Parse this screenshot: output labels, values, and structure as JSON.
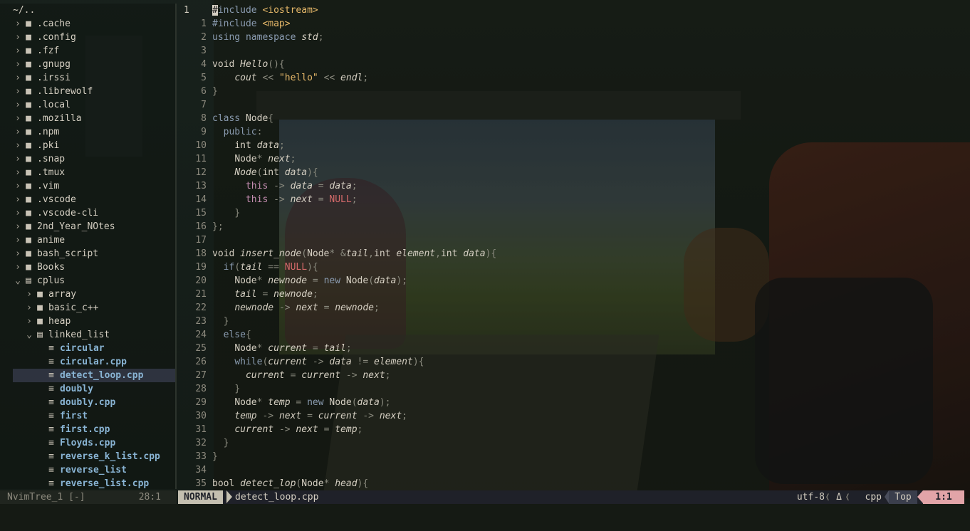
{
  "tree": {
    "root": "~/..",
    "items": [
      {
        "label": ".cache",
        "type": "folder",
        "depth": 0,
        "open": false
      },
      {
        "label": ".config",
        "type": "folder",
        "depth": 0,
        "open": false
      },
      {
        "label": ".fzf",
        "type": "folder",
        "depth": 0,
        "open": false
      },
      {
        "label": ".gnupg",
        "type": "folder",
        "depth": 0,
        "open": false
      },
      {
        "label": ".irssi",
        "type": "folder",
        "depth": 0,
        "open": false
      },
      {
        "label": ".librewolf",
        "type": "folder",
        "depth": 0,
        "open": false
      },
      {
        "label": ".local",
        "type": "folder",
        "depth": 0,
        "open": false
      },
      {
        "label": ".mozilla",
        "type": "folder",
        "depth": 0,
        "open": false
      },
      {
        "label": ".npm",
        "type": "folder",
        "depth": 0,
        "open": false
      },
      {
        "label": ".pki",
        "type": "folder",
        "depth": 0,
        "open": false
      },
      {
        "label": ".snap",
        "type": "folder",
        "depth": 0,
        "open": false
      },
      {
        "label": ".tmux",
        "type": "folder",
        "depth": 0,
        "open": false
      },
      {
        "label": ".vim",
        "type": "folder",
        "depth": 0,
        "open": false
      },
      {
        "label": ".vscode",
        "type": "folder",
        "depth": 0,
        "open": false
      },
      {
        "label": ".vscode-cli",
        "type": "folder",
        "depth": 0,
        "open": false
      },
      {
        "label": "2nd_Year_NOtes",
        "type": "folder",
        "depth": 0,
        "open": false
      },
      {
        "label": "anime",
        "type": "folder",
        "depth": 0,
        "open": false
      },
      {
        "label": "bash_script",
        "type": "folder",
        "depth": 0,
        "open": false
      },
      {
        "label": "Books",
        "type": "folder",
        "depth": 0,
        "open": false
      },
      {
        "label": "cplus",
        "type": "folder",
        "depth": 0,
        "open": true
      },
      {
        "label": "array",
        "type": "folder",
        "depth": 1,
        "open": false
      },
      {
        "label": "basic_c++",
        "type": "folder",
        "depth": 1,
        "open": false
      },
      {
        "label": "heap",
        "type": "folder",
        "depth": 1,
        "open": false
      },
      {
        "label": "linked_list",
        "type": "folder",
        "depth": 1,
        "open": true
      },
      {
        "label": "circular",
        "type": "file",
        "depth": 2
      },
      {
        "label": "circular.cpp",
        "type": "file",
        "depth": 2
      },
      {
        "label": "detect_loop.cpp",
        "type": "file",
        "depth": 2,
        "selected": true
      },
      {
        "label": "doubly",
        "type": "file",
        "depth": 2
      },
      {
        "label": "doubly.cpp",
        "type": "file",
        "depth": 2
      },
      {
        "label": "first",
        "type": "file",
        "depth": 2
      },
      {
        "label": "first.cpp",
        "type": "file",
        "depth": 2
      },
      {
        "label": "Floyds.cpp",
        "type": "file",
        "depth": 2
      },
      {
        "label": "reverse_k_list.cpp",
        "type": "file",
        "depth": 2
      },
      {
        "label": "reverse_list",
        "type": "file",
        "depth": 2
      },
      {
        "label": "reverse_list.cpp",
        "type": "file",
        "depth": 2
      }
    ]
  },
  "editor": {
    "lines": [
      {
        "n": "1",
        "cur": true,
        "html": "<span class=\"cursor\">#</span><span class=\"inc\">include</span> <span class=\"ang\">&lt;iostream&gt;</span>"
      },
      {
        "n": "1",
        "html": "<span class=\"inc\">#include</span> <span class=\"ang\">&lt;map&gt;</span>"
      },
      {
        "n": "2",
        "html": "<span class=\"k\">using namespace</span> <span class=\"v\">std</span><span class=\"p\">;</span>"
      },
      {
        "n": "3",
        "html": ""
      },
      {
        "n": "4",
        "html": "<span class=\"t\">void</span> <span class=\"fn\">Hello</span><span class=\"p\">(){</span>"
      },
      {
        "n": "5",
        "html": "    <span class=\"v\">cout</span> <span class=\"p\">&lt;&lt;</span> <span class=\"s\">\"hello\"</span> <span class=\"p\">&lt;&lt;</span> <span class=\"v\">endl</span><span class=\"p\">;</span>"
      },
      {
        "n": "6",
        "html": "<span class=\"p\">}</span>"
      },
      {
        "n": "7",
        "html": ""
      },
      {
        "n": "8",
        "html": "<span class=\"k\">class</span> <span class=\"t\">Node</span><span class=\"p\">{</span>"
      },
      {
        "n": "9",
        "html": "  <span class=\"k\">public</span><span class=\"p\">:</span>"
      },
      {
        "n": "10",
        "html": "    <span class=\"t\">int</span> <span class=\"v\">data</span><span class=\"p\">;</span>"
      },
      {
        "n": "11",
        "html": "    <span class=\"t\">Node</span><span class=\"p\">*</span> <span class=\"v\">next</span><span class=\"p\">;</span>"
      },
      {
        "n": "12",
        "html": "    <span class=\"fn\">Node</span><span class=\"p\">(</span><span class=\"t\">int</span> <span class=\"v\">data</span><span class=\"p\">){</span>"
      },
      {
        "n": "13",
        "html": "      <span class=\"m\">this</span> <span class=\"arrow\">-&gt;</span> <span class=\"v\">data</span> <span class=\"p\">=</span> <span class=\"v\">data</span><span class=\"p\">;</span>"
      },
      {
        "n": "14",
        "html": "      <span class=\"m\">this</span> <span class=\"arrow\">-&gt;</span> <span class=\"v\">next</span> <span class=\"p\">=</span> <span class=\"nul\">NULL</span><span class=\"p\">;</span>"
      },
      {
        "n": "15",
        "html": "    <span class=\"p\">}</span>"
      },
      {
        "n": "16",
        "html": "<span class=\"p\">};</span>"
      },
      {
        "n": "17",
        "html": ""
      },
      {
        "n": "18",
        "html": "<span class=\"t\">void</span> <span class=\"fn\">insert_node</span><span class=\"p\">(</span><span class=\"t\">Node</span><span class=\"p\">*</span> <span class=\"p\">&amp;</span><span class=\"v\">tail</span><span class=\"p\">,</span><span class=\"t\">int</span> <span class=\"v\">element</span><span class=\"p\">,</span><span class=\"t\">int</span> <span class=\"v\">data</span><span class=\"p\">){</span>"
      },
      {
        "n": "19",
        "html": "  <span class=\"k\">if</span><span class=\"p\">(</span><span class=\"v\">tail</span> <span class=\"p\">==</span> <span class=\"nul\">NULL</span><span class=\"p\">){</span>"
      },
      {
        "n": "20",
        "html": "    <span class=\"t\">Node</span><span class=\"p\">*</span> <span class=\"v\">newnode</span> <span class=\"p\">=</span> <span class=\"k\">new</span> <span class=\"t\">Node</span><span class=\"p\">(</span><span class=\"v\">data</span><span class=\"p\">);</span>"
      },
      {
        "n": "21",
        "html": "    <span class=\"v\">tail</span> <span class=\"p\">=</span> <span class=\"v\">newnode</span><span class=\"p\">;</span>"
      },
      {
        "n": "22",
        "html": "    <span class=\"v\">newnode</span> <span class=\"arrow\">-&gt;</span> <span class=\"v\">next</span> <span class=\"p\">=</span> <span class=\"v\">newnode</span><span class=\"p\">;</span>"
      },
      {
        "n": "23",
        "html": "  <span class=\"p\">}</span>"
      },
      {
        "n": "24",
        "html": "  <span class=\"k\">else</span><span class=\"p\">{</span>"
      },
      {
        "n": "25",
        "html": "    <span class=\"t\">Node</span><span class=\"p\">*</span> <span class=\"v\">current</span> <span class=\"p\">=</span> <span class=\"v\">tail</span><span class=\"p\">;</span>"
      },
      {
        "n": "26",
        "html": "    <span class=\"k\">while</span><span class=\"p\">(</span><span class=\"v\">current</span> <span class=\"arrow\">-&gt;</span> <span class=\"v\">data</span> <span class=\"p\">!=</span> <span class=\"v\">element</span><span class=\"p\">){</span>"
      },
      {
        "n": "27",
        "html": "      <span class=\"v\">current</span> <span class=\"p\">=</span> <span class=\"v\">current</span> <span class=\"arrow\">-&gt;</span> <span class=\"v\">next</span><span class=\"p\">;</span>"
      },
      {
        "n": "28",
        "html": "    <span class=\"p\">}</span>"
      },
      {
        "n": "29",
        "html": "    <span class=\"t\">Node</span><span class=\"p\">*</span> <span class=\"v\">temp</span> <span class=\"p\">=</span> <span class=\"k\">new</span> <span class=\"t\">Node</span><span class=\"p\">(</span><span class=\"v\">data</span><span class=\"p\">);</span>"
      },
      {
        "n": "30",
        "html": "    <span class=\"v\">temp</span> <span class=\"arrow\">-&gt;</span> <span class=\"v\">next</span> <span class=\"p\">=</span> <span class=\"v\">current</span> <span class=\"arrow\">-&gt;</span> <span class=\"v\">next</span><span class=\"p\">;</span>"
      },
      {
        "n": "31",
        "html": "    <span class=\"v\">current</span> <span class=\"arrow\">-&gt;</span> <span class=\"v\">next</span> <span class=\"p\">=</span> <span class=\"v\">temp</span><span class=\"p\">;</span>"
      },
      {
        "n": "32",
        "html": "  <span class=\"p\">}</span>"
      },
      {
        "n": "33",
        "html": "<span class=\"p\">}</span>"
      },
      {
        "n": "34",
        "html": ""
      },
      {
        "n": "35",
        "html": "<span class=\"t\">bool</span> <span class=\"fn\">detect_lop</span><span class=\"p\">(</span><span class=\"t\">Node</span><span class=\"p\">*</span> <span class=\"v\">head</span><span class=\"p\">){</span>"
      }
    ]
  },
  "statusline": {
    "tree_name": "NvimTree_1 [-]",
    "tree_pos": "28:1",
    "mode": "NORMAL",
    "file": "detect_loop.cpp",
    "encoding": "utf-8",
    "sep": "❬",
    "format_icon": "Δ",
    "filetype": "cpp",
    "scroll": "Top",
    "position": "1:1"
  },
  "colors": {
    "mode_bg": "#c4bfb0",
    "position_bg": "#e2a4a8",
    "selected_row": "#343846",
    "file_name": "#89b4d4",
    "string": "#e6b869",
    "null": "#d46a6a",
    "this": "#c48db0"
  }
}
